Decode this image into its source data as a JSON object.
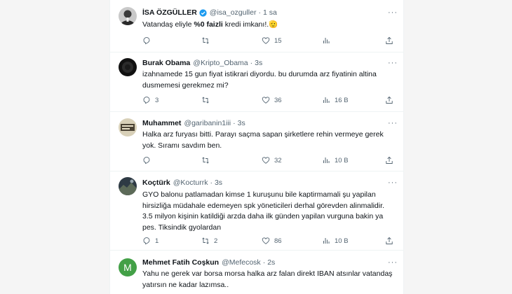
{
  "tweets": [
    {
      "author": "İSA ÖZGÜLLER",
      "handle": "@isa_ozguller",
      "time": "1 sa",
      "verified": true,
      "avatar_icon": "portrait-avatar",
      "text_before": "Vatandaş eliyle ",
      "text_bold": "%0 faizli",
      "text_after": " kredi imkanı!.🫡",
      "counts": {
        "replies": "",
        "retweets": "",
        "likes": "15",
        "views": ""
      }
    },
    {
      "author": "Burak Obama",
      "handle": "@Kripto_Obama",
      "time": "3s",
      "avatar_icon": "dark-avatar",
      "text": "izahnamede 15 gun fiyat istikrari diyordu. bu durumda arz fiyatinin altina dusmemesi gerekmez mi?",
      "counts": {
        "replies": "3",
        "retweets": "",
        "likes": "36",
        "views": "16 B"
      }
    },
    {
      "author": "Muhammet",
      "handle": "@garibanin1iii",
      "time": "3s",
      "avatar_icon": "sign-avatar",
      "text": "Halka arz furyası bitti. Parayı saçma sapan şirketlere rehin vermeye gerek yok. Sıramı savdım ben.",
      "counts": {
        "replies": "",
        "retweets": "",
        "likes": "32",
        "views": "10 B"
      }
    },
    {
      "author": "Koçtürk",
      "handle": "@Kocturrk",
      "time": "3s",
      "avatar_icon": "landscape-avatar",
      "text": "GYO balonu patlamadan kimse 1 kuruşunu bile kaptirmamali şu yapilan hirsizliğa müdahale edemeyen spk yöneticileri derhal görevden alinmalidir. 3.5 milyon kişinin katildiği arzda daha ilk günden yapilan vurguna bakin ya pes. Tiksindik gyolardan",
      "counts": {
        "replies": "1",
        "retweets": "2",
        "likes": "86",
        "views": "10 B"
      }
    },
    {
      "author": "Mehmet Fatih Coşkun",
      "handle": "@Mefecosk",
      "time": "2s",
      "avatar_letter": "M",
      "text": "Yahu ne gerek var borsa morsa halka arz falan direkt IBAN atsınlar vatandaş yatırsın ne kadar lazımsa..",
      "counts": {
        "replies": "",
        "retweets": "",
        "likes": "",
        "views": ""
      }
    }
  ],
  "icons": {
    "more": "more-icon",
    "reply": "reply-icon",
    "retweet": "retweet-icon",
    "like": "heart-icon",
    "views": "views-icon"
  },
  "colors": {
    "verified": "#1d9bf0",
    "letter_avatar": "#43a047",
    "muted": "#536471"
  }
}
